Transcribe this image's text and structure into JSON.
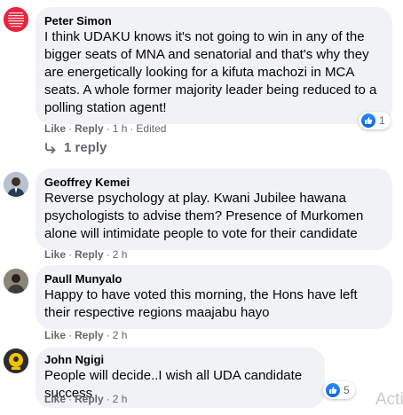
{
  "actions": {
    "like": "Like",
    "reply": "Reply",
    "separator": "·",
    "edited": "Edited"
  },
  "comments": [
    {
      "author": "Peter Simon",
      "text": "I think UDAKU knows it's not going to win in any of the bigger seats of MNA and senatorial and that's why they are energetically looking for a kifuta machozi in MCA seats. A whole former majority leader being reduced to a polling station agent!",
      "time": "1 h",
      "reactions": "1",
      "replies_label": "1 reply",
      "avatar_color": "#e8243f"
    },
    {
      "author": "Geoffrey Kemei",
      "text": "Reverse psychology at play. Kwani Jubilee hawana psychologists to advise them? Presence of Murkomen alone will intimidate people to vote for their candidate",
      "time": "2 h"
    },
    {
      "author": "Paull Munyalo",
      "text": "Happy to have voted this morning, the Hons have left their respective regions maajabu hayo",
      "time": "2 h"
    },
    {
      "author": "John Ngigi",
      "text": "People will decide..I wish all UDA candidate success",
      "time": "2 h",
      "reactions": "5",
      "avatar_badge": "UDA"
    }
  ],
  "watermark": "Acti",
  "colors": {
    "bubble": "#f0f2f5",
    "secondary_text": "#65676b",
    "like_blue": "#1877f2"
  }
}
